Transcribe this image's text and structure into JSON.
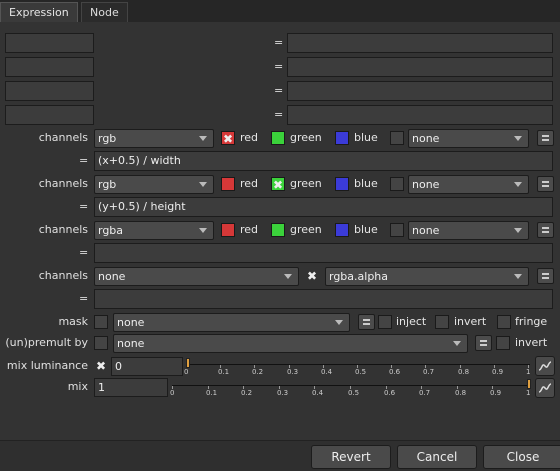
{
  "tabs": [
    "Expression",
    "Node"
  ],
  "eq": "=",
  "channels_label": "channels",
  "expr_rows": [
    {
      "channels": "rgb",
      "red_checked": true,
      "green_checked": false,
      "blue_checked": false,
      "extra_checked": false,
      "extra": "none",
      "expression": "(x+0.5) / width"
    },
    {
      "channels": "rgb",
      "red_checked": false,
      "green_checked": true,
      "blue_checked": false,
      "extra_checked": false,
      "extra": "none",
      "expression": "(y+0.5) / height"
    },
    {
      "channels": "rgba",
      "red_checked": false,
      "green_checked": false,
      "blue_checked": false,
      "extra_checked": false,
      "extra": "none",
      "expression": ""
    }
  ],
  "colors": {
    "red": "#d63838",
    "green": "#3bd23b",
    "blue": "#3b3bd8",
    "accent": "#e0a040"
  },
  "channel_names": {
    "red": "red",
    "green": "green",
    "blue": "blue"
  },
  "alpha_row": {
    "channels": "none",
    "extra": "rgba.alpha",
    "expression": ""
  },
  "mask": {
    "label": "mask",
    "value": "none",
    "inject": "inject",
    "invert": "invert",
    "fringe": "fringe"
  },
  "premult": {
    "label": "(un)premult by",
    "value": "none",
    "invert": "invert"
  },
  "mix_luminance": {
    "label": "mix luminance",
    "value": "0"
  },
  "mix": {
    "label": "mix",
    "value": "1"
  },
  "slider_ticks": [
    "0",
    "0.1",
    "0.2",
    "0.3",
    "0.4",
    "0.5",
    "0.6",
    "0.7",
    "0.8",
    "0.9",
    "1"
  ],
  "buttons": {
    "revert": "Revert",
    "cancel": "Cancel",
    "close": "Close"
  }
}
